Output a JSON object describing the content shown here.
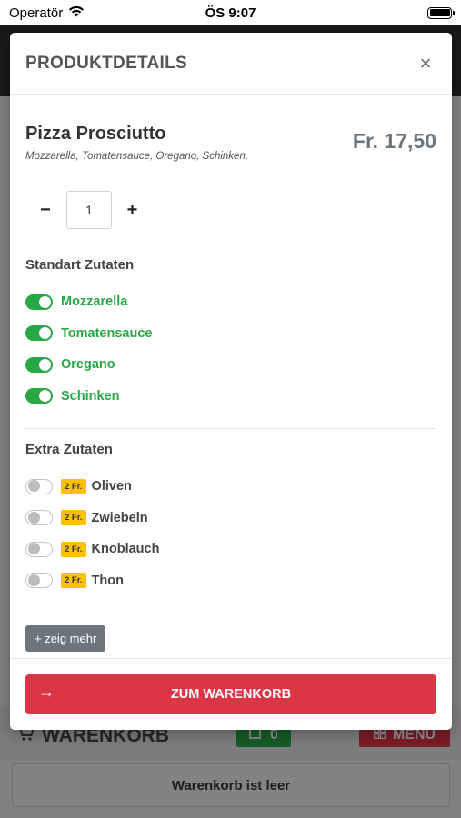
{
  "status_bar": {
    "carrier": "Operatör",
    "time": "ÖS 9:07"
  },
  "background": {
    "cart_title": "WARENKORB",
    "cart_count": "0",
    "menu_label": "MENU",
    "empty_cart_text": "Warenkorb ist leer"
  },
  "modal": {
    "title": "PRODUKTDETAILS",
    "close_symbol": "×",
    "product": {
      "name": "Pizza Prosciutto",
      "description": "Mozzarella, Tomatensauce, Oregano, Schinken,",
      "price": "Fr. 17,50"
    },
    "quantity": {
      "minus": "−",
      "value": "1",
      "plus": "+"
    },
    "standard_section_title": "Standart Zutaten",
    "standard_ingredients": [
      {
        "label": "Mozzarella",
        "enabled": true
      },
      {
        "label": "Tomatensauce",
        "enabled": true
      },
      {
        "label": "Oregano",
        "enabled": true
      },
      {
        "label": "Schinken",
        "enabled": true
      }
    ],
    "extra_section_title": "Extra Zutaten",
    "extra_ingredients": [
      {
        "price": "2 Fr.",
        "label": "Oliven",
        "enabled": false
      },
      {
        "price": "2 Fr.",
        "label": "Zwiebeln",
        "enabled": false
      },
      {
        "price": "2 Fr.",
        "label": "Knoblauch",
        "enabled": false
      },
      {
        "price": "2 Fr.",
        "label": "Thon",
        "enabled": false
      }
    ],
    "show_more_label": "+ zeig mehr",
    "cart_button": {
      "arrow": "→",
      "label": "ZUM WARENKORB"
    }
  },
  "colors": {
    "accent_green": "#28a745",
    "accent_red": "#dc3545",
    "badge_yellow": "#ffc107",
    "muted_button": "#6c757d"
  }
}
